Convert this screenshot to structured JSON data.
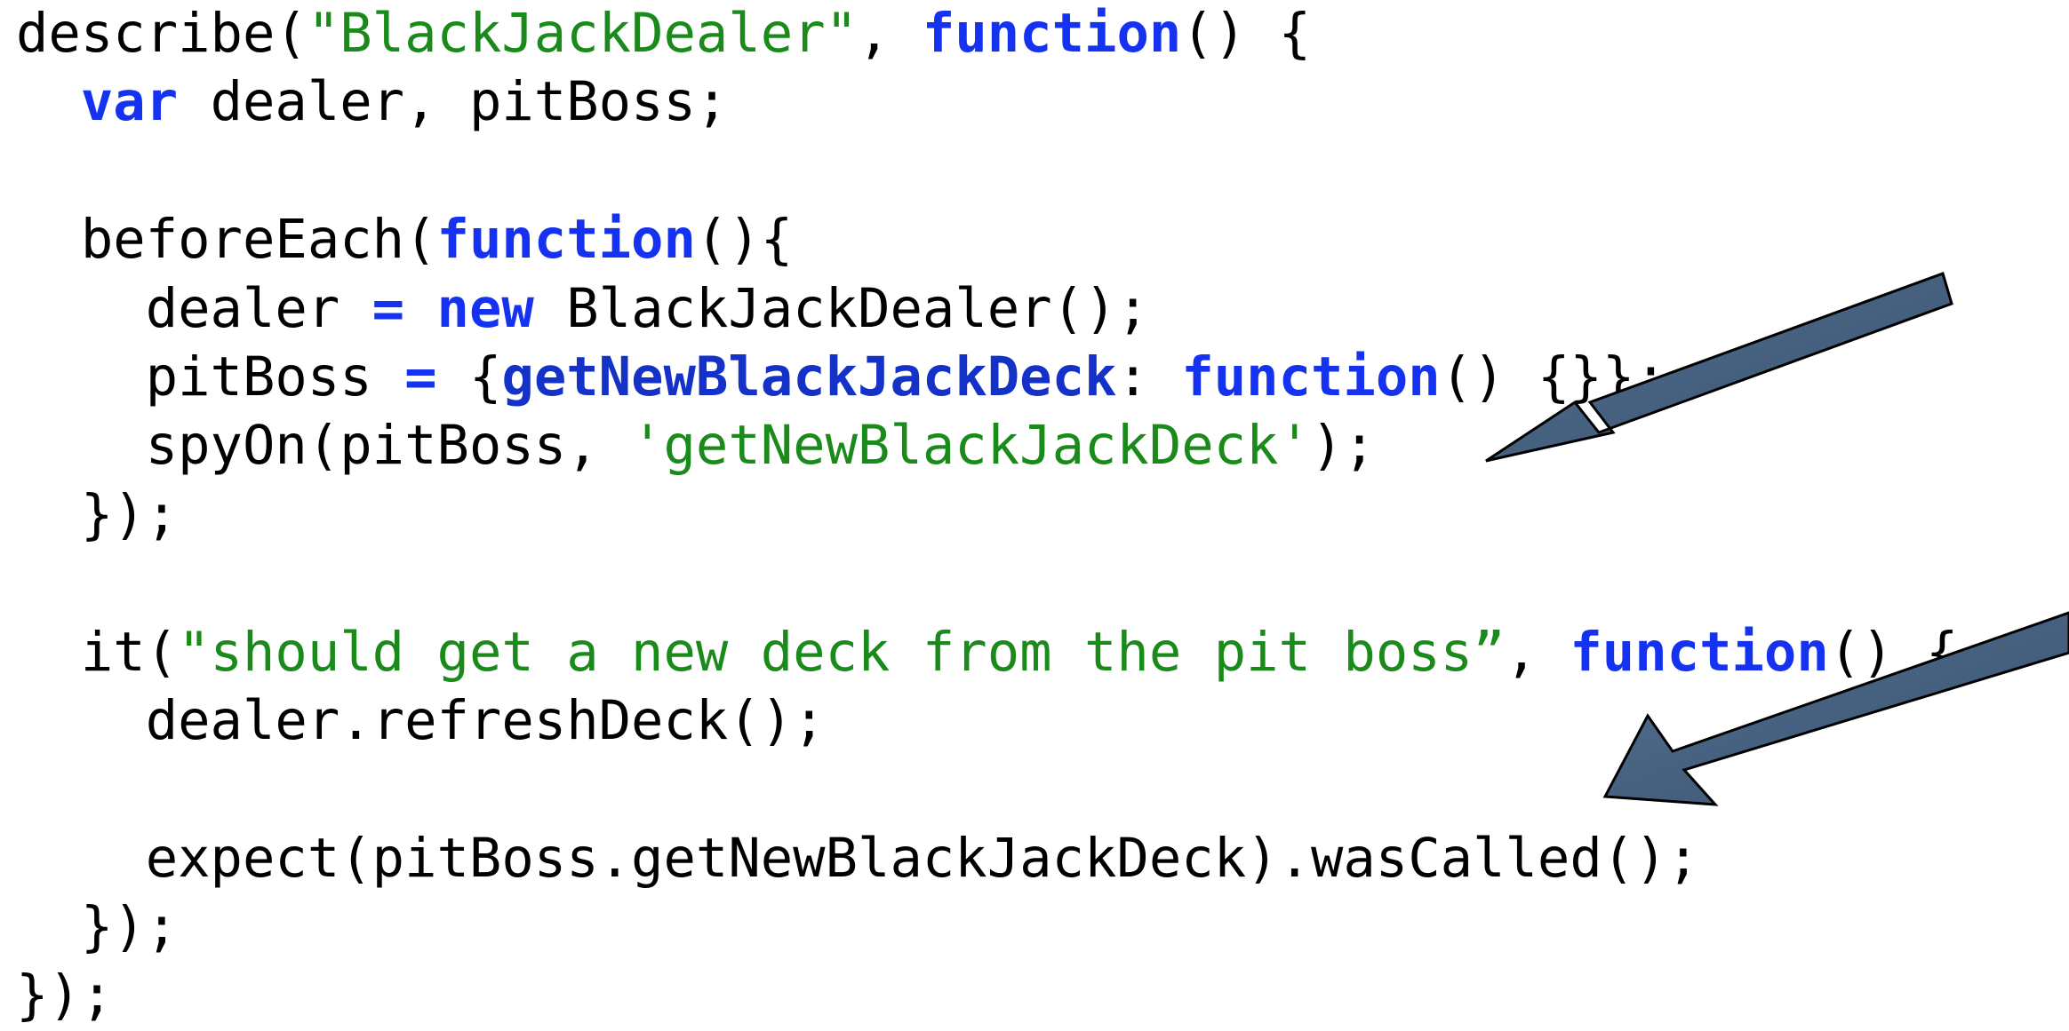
{
  "code": {
    "lines": [
      [
        {
          "text": "describe(",
          "t": "plain"
        },
        {
          "text": "\"BlackJackDealer\"",
          "t": "str"
        },
        {
          "text": ", ",
          "t": "plain"
        },
        {
          "text": "function",
          "t": "kw"
        },
        {
          "text": "() {",
          "t": "plain"
        }
      ],
      [
        {
          "text": "  ",
          "t": "plain"
        },
        {
          "text": "var",
          "t": "kw"
        },
        {
          "text": " dealer, pitBoss;",
          "t": "plain"
        }
      ],
      [],
      [
        {
          "text": "  beforeEach(",
          "t": "plain"
        },
        {
          "text": "function",
          "t": "kw"
        },
        {
          "text": "(){",
          "t": "plain"
        }
      ],
      [
        {
          "text": "    dealer ",
          "t": "plain"
        },
        {
          "text": "=",
          "t": "kw"
        },
        {
          "text": " ",
          "t": "plain"
        },
        {
          "text": "new",
          "t": "kw"
        },
        {
          "text": " BlackJackDealer();",
          "t": "plain"
        }
      ],
      [
        {
          "text": "    pitBoss ",
          "t": "plain"
        },
        {
          "text": "=",
          "t": "kw"
        },
        {
          "text": " {",
          "t": "plain"
        },
        {
          "text": "getNewBlackJackDeck",
          "t": "prop"
        },
        {
          "text": ": ",
          "t": "plain"
        },
        {
          "text": "function",
          "t": "kw"
        },
        {
          "text": "() {}};",
          "t": "plain"
        }
      ],
      [
        {
          "text": "    spyOn(pitBoss, ",
          "t": "plain"
        },
        {
          "text": "'getNewBlackJackDeck'",
          "t": "str"
        },
        {
          "text": ");",
          "t": "plain"
        }
      ],
      [
        {
          "text": "  });",
          "t": "plain"
        }
      ],
      [],
      [
        {
          "text": "  it(",
          "t": "plain"
        },
        {
          "text": "\"should get a new deck from the pit boss”",
          "t": "str"
        },
        {
          "text": ", ",
          "t": "plain"
        },
        {
          "text": "function",
          "t": "kw"
        },
        {
          "text": "() {",
          "t": "plain"
        }
      ],
      [
        {
          "text": "    dealer.refreshDeck();",
          "t": "plain"
        }
      ],
      [],
      [
        {
          "text": "    expect(pitBoss.getNewBlackJackDeck).wasCalled();",
          "t": "plain"
        }
      ],
      [
        {
          "text": "  });",
          "t": "plain"
        }
      ],
      [
        {
          "text": "});",
          "t": "plain"
        }
      ]
    ]
  },
  "colors": {
    "keyword": "#1432f0",
    "property": "#1432c8",
    "string": "#1a8a1a",
    "plain": "#000000",
    "arrow_fill": "#4a6585",
    "arrow_stroke": "#000000"
  },
  "annotations": [
    {
      "icon": "arrow-icon",
      "points_to": "spyOn(pitBoss, 'getNewBlackJackDeck');"
    },
    {
      "icon": "arrow-icon",
      "points_to": "expect(pitBoss.getNewBlackJackDeck).wasCalled();"
    }
  ]
}
